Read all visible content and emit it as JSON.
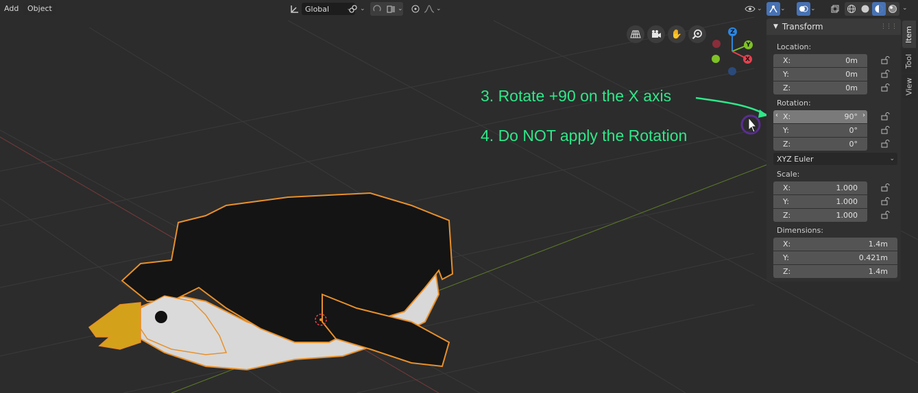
{
  "header": {
    "add_label": "Add",
    "object_label": "Object",
    "orientation_value": "Global"
  },
  "annotations": {
    "step3": "3. Rotate +90 on the X axis",
    "step4": "4. Do NOT apply the Rotation"
  },
  "gizmo": {
    "z": "Z",
    "y": "Y",
    "x": "X"
  },
  "sidebar": {
    "panel_title": "Transform",
    "location": {
      "label": "Location:",
      "x_label": "X:",
      "x": "0m",
      "y_label": "Y:",
      "y": "0m",
      "z_label": "Z:",
      "z": "0m"
    },
    "rotation": {
      "label": "Rotation:",
      "x_label": "X:",
      "x": "90°",
      "y_label": "Y:",
      "y": "0°",
      "z_label": "Z:",
      "z": "0°",
      "mode": "XYZ Euler"
    },
    "scale": {
      "label": "Scale:",
      "x_label": "X:",
      "x": "1.000",
      "y_label": "Y:",
      "y": "1.000",
      "z_label": "Z:",
      "z": "1.000"
    },
    "dimensions": {
      "label": "Dimensions:",
      "x_label": "X:",
      "x": "1.4m",
      "y_label": "Y:",
      "y": "0.421m",
      "z_label": "Z:",
      "z": "1.4m"
    }
  },
  "tabs": [
    "Item",
    "Tool",
    "View"
  ],
  "colors": {
    "annotation": "#2ee889",
    "selection_outline": "#e8902a",
    "active_button": "#4772b3",
    "axis_x": "#e8414e",
    "axis_y": "#7ec226",
    "axis_z": "#2e86de"
  }
}
